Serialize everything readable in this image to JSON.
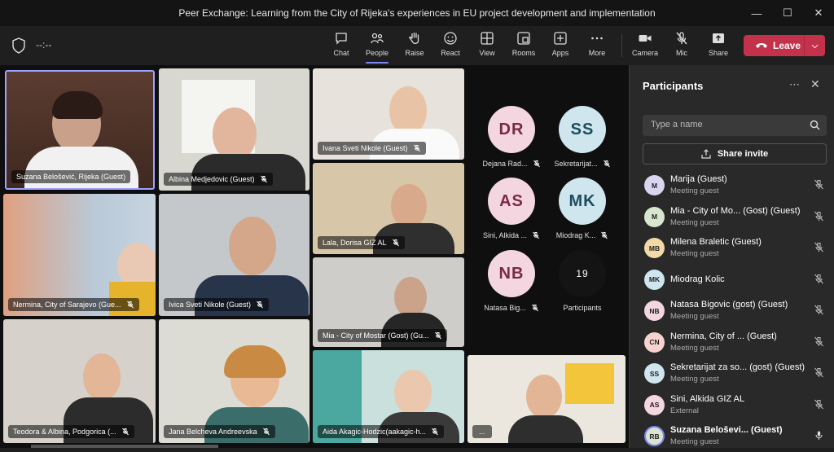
{
  "window": {
    "title": "Peer Exchange: Learning from the City of Rijeka's experiences in EU project development and implementation"
  },
  "toolbar": {
    "timer": "--:--",
    "buttons": [
      {
        "label": "Chat",
        "icon": "chat-icon"
      },
      {
        "label": "People",
        "icon": "people-icon",
        "active": true
      },
      {
        "label": "Raise",
        "icon": "raise-hand-icon"
      },
      {
        "label": "React",
        "icon": "react-icon"
      },
      {
        "label": "View",
        "icon": "view-icon"
      },
      {
        "label": "Rooms",
        "icon": "rooms-icon"
      },
      {
        "label": "Apps",
        "icon": "apps-icon"
      },
      {
        "label": "More",
        "icon": "more-icon"
      },
      {
        "label": "Camera",
        "icon": "camera-icon"
      },
      {
        "label": "Mic",
        "icon": "mic-off-icon"
      },
      {
        "label": "Share",
        "icon": "share-icon"
      }
    ],
    "leave_label": "Leave",
    "leave_color": "#c4314b",
    "accent_color": "#7f85f5"
  },
  "tiles": [
    {
      "name": "Suzana Belošević, Rijeka (Guest)",
      "muted": false,
      "speaking": true
    },
    {
      "name": "Albina Medjedovic (Guest)",
      "muted": true
    },
    {
      "name": "Ivana Sveti Nikole (Guest)",
      "muted": true
    },
    {
      "name": "Nermina, City of Sarajevo (Gue...",
      "muted": true
    },
    {
      "name": "Ivica Sveti Nikole (Guest)",
      "muted": true
    },
    {
      "name": "Lala, Dorisa GIZ AL",
      "muted": true
    },
    {
      "name": "Mia - City of Mostar (Gost) (Gu...",
      "muted": true
    },
    {
      "name": "Teodora & Albina, Podgorica (...",
      "muted": true
    },
    {
      "name": "Jana Belcheva Andreevska",
      "muted": true
    },
    {
      "name": "Aida Akagic-Hodzic(aakagic-h...",
      "muted": true
    },
    {
      "name": "...",
      "muted": false
    }
  ],
  "avatars": [
    {
      "initials": "DR",
      "caption": "Dejana Rad...",
      "bg": "#f3d6e0",
      "fg": "#7a2a46"
    },
    {
      "initials": "SS",
      "caption": "Sekretarijat...",
      "bg": "#cfe6ee",
      "fg": "#1c4d5e"
    },
    {
      "initials": "AS",
      "caption": "Sini, Alkida ...",
      "bg": "#f3d6e0",
      "fg": "#7a2a46"
    },
    {
      "initials": "MK",
      "caption": "Miodrag K...",
      "bg": "#cfe6ee",
      "fg": "#1c4d5e"
    },
    {
      "initials": "NB",
      "caption": "Natasa Big...",
      "bg": "#f3d6e0",
      "fg": "#7a2a46"
    }
  ],
  "overflow": {
    "count": "19",
    "label": "Participants"
  },
  "panel": {
    "title": "Participants",
    "search_placeholder": "Type a name",
    "share_label": "Share invite",
    "participants": [
      {
        "initials": "M",
        "name": "Marija (Guest)",
        "sub": "Meeting guest",
        "bg": "#d9d4f0",
        "muted": true
      },
      {
        "initials": "M",
        "name": "Mia - City of Mo...  (Gost) (Guest)",
        "sub": "Meeting guest",
        "bg": "#d8e6cf",
        "muted": true
      },
      {
        "initials": "MB",
        "name": "Milena Braletic (Guest)",
        "sub": "Meeting guest",
        "bg": "#f2d9a8",
        "muted": true
      },
      {
        "initials": "MK",
        "name": "Miodrag Kolic",
        "sub": "",
        "bg": "#cfe6ee",
        "muted": true
      },
      {
        "initials": "NB",
        "name": "Natasa Bigovic (gost) (Guest)",
        "sub": "Meeting guest",
        "bg": "#f3d6e0",
        "muted": true
      },
      {
        "initials": "CN",
        "name": "Nermina, City of ...  (Guest)",
        "sub": "Meeting guest",
        "bg": "#f6d3cf",
        "muted": true
      },
      {
        "initials": "SS",
        "name": "Sekretarijat za so...  (gost) (Guest)",
        "sub": "Meeting guest",
        "bg": "#cfe6ee",
        "muted": true
      },
      {
        "initials": "AS",
        "name": "Sini, Alkida GIZ AL",
        "sub": "External",
        "bg": "#f3d6e0",
        "muted": true
      },
      {
        "initials": "RB",
        "name": "Suzana Beloševi...  (Guest)",
        "sub": "Meeting guest",
        "bg": "#d9e3cf",
        "muted": false
      }
    ]
  }
}
